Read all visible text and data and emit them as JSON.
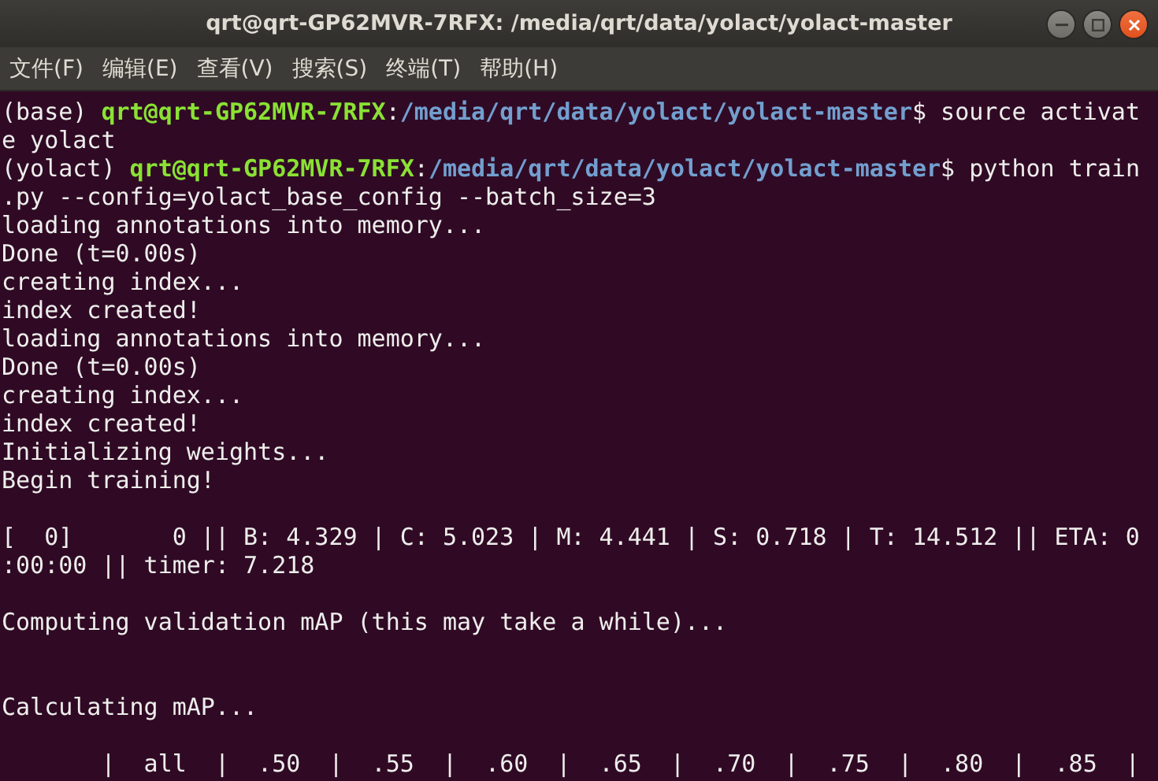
{
  "window": {
    "title": "qrt@qrt-GP62MVR-7RFX: /media/qrt/data/yolact/yolact-master"
  },
  "menu": [
    "文件(F)",
    "编辑(E)",
    "查看(V)",
    "搜索(S)",
    "终端(T)",
    "帮助(H)"
  ],
  "terminal": {
    "lines": [
      {
        "kind": "text",
        "segments": [
          {
            "kind": "plain",
            "text": "(base) "
          },
          {
            "kind": "user",
            "text": "qrt@qrt-GP62MVR-7RFX"
          },
          {
            "kind": "plain",
            "text": ":"
          },
          {
            "kind": "path",
            "text": "/media/qrt/data/yolact/yolact-master"
          },
          {
            "kind": "plain",
            "text": "$ source activat"
          }
        ]
      },
      {
        "kind": "text",
        "segments": [
          {
            "kind": "plain",
            "text": "e yolact"
          }
        ]
      },
      {
        "kind": "text",
        "segments": [
          {
            "kind": "plain",
            "text": "(yolact) "
          },
          {
            "kind": "user",
            "text": "qrt@qrt-GP62MVR-7RFX"
          },
          {
            "kind": "plain",
            "text": ":"
          },
          {
            "kind": "path",
            "text": "/media/qrt/data/yolact/yolact-master"
          },
          {
            "kind": "plain",
            "text": "$ python train"
          }
        ]
      },
      {
        "kind": "text",
        "segments": [
          {
            "kind": "plain",
            "text": ".py --config=yolact_base_config --batch_size=3"
          }
        ]
      },
      {
        "kind": "text",
        "segments": [
          {
            "kind": "plain",
            "text": "loading annotations into memory..."
          }
        ]
      },
      {
        "kind": "text",
        "segments": [
          {
            "kind": "plain",
            "text": "Done (t=0.00s)"
          }
        ]
      },
      {
        "kind": "text",
        "segments": [
          {
            "kind": "plain",
            "text": "creating index..."
          }
        ]
      },
      {
        "kind": "text",
        "segments": [
          {
            "kind": "plain",
            "text": "index created!"
          }
        ]
      },
      {
        "kind": "text",
        "segments": [
          {
            "kind": "plain",
            "text": "loading annotations into memory..."
          }
        ]
      },
      {
        "kind": "text",
        "segments": [
          {
            "kind": "plain",
            "text": "Done (t=0.00s)"
          }
        ]
      },
      {
        "kind": "text",
        "segments": [
          {
            "kind": "plain",
            "text": "creating index..."
          }
        ]
      },
      {
        "kind": "text",
        "segments": [
          {
            "kind": "plain",
            "text": "index created!"
          }
        ]
      },
      {
        "kind": "text",
        "segments": [
          {
            "kind": "plain",
            "text": "Initializing weights..."
          }
        ]
      },
      {
        "kind": "text",
        "segments": [
          {
            "kind": "plain",
            "text": "Begin training!"
          }
        ]
      },
      {
        "kind": "blank"
      },
      {
        "kind": "text",
        "segments": [
          {
            "kind": "plain",
            "text": "[  0]       0 || B: 4.329 | C: 5.023 | M: 4.441 | S: 0.718 | T: 14.512 || ETA: 0"
          }
        ]
      },
      {
        "kind": "text",
        "segments": [
          {
            "kind": "plain",
            "text": ":00:00 || timer: 7.218"
          }
        ]
      },
      {
        "kind": "blank"
      },
      {
        "kind": "text",
        "segments": [
          {
            "kind": "plain",
            "text": "Computing validation mAP (this may take a while)..."
          }
        ]
      },
      {
        "kind": "blank"
      },
      {
        "kind": "blank"
      },
      {
        "kind": "text",
        "segments": [
          {
            "kind": "plain",
            "text": "Calculating mAP..."
          }
        ]
      },
      {
        "kind": "blank"
      },
      {
        "kind": "text",
        "segments": [
          {
            "kind": "plain",
            "text": "       |  all  |  .50  |  .55  |  .60  |  .65  |  .70  |  .75  |  .80  |  .85  |"
          }
        ]
      }
    ]
  }
}
